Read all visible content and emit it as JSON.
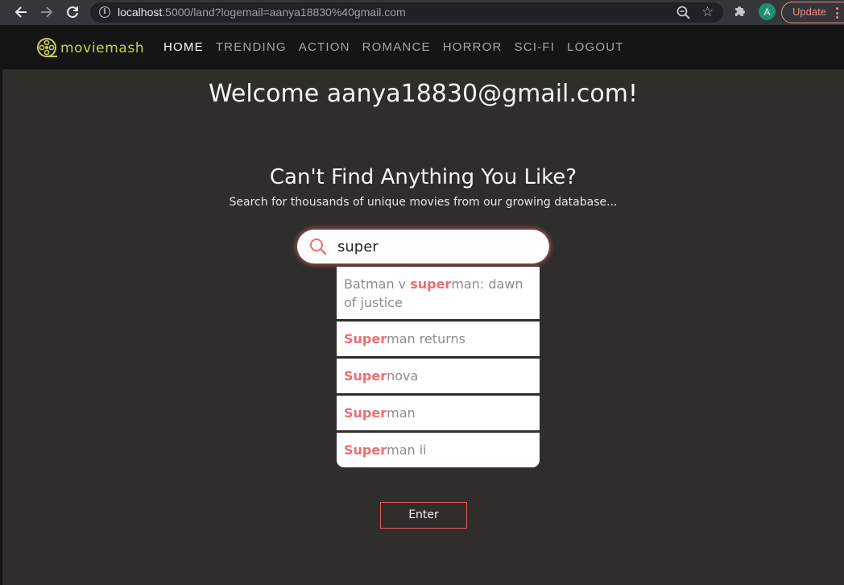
{
  "browser": {
    "url_host": "localhost",
    "url_rest": ":5000/land?logemail=aanya18830%40gmail.com",
    "profile_initial": "A",
    "update_label": "Update",
    "icons": [
      "back-arrow-icon",
      "forward-arrow-icon",
      "reload-icon",
      "site-info-icon",
      "zoom-icon",
      "bookmark-star-icon",
      "extensions-puzzle-icon",
      "kebab-menu-icon"
    ]
  },
  "site": {
    "logo_text": "moviemash",
    "nav": [
      "HOME",
      "TRENDING",
      "ACTION",
      "ROMANCE",
      "HORROR",
      "SCI-FI",
      "LOGOUT"
    ],
    "active_nav": "HOME"
  },
  "main": {
    "welcome": "Welcome aanya18830@gmail.com!",
    "headline": "Can't Find Anything You Like?",
    "subline": "Search for thousands of unique movies from our growing database...",
    "search_value": "super",
    "suggestions": [
      {
        "before": "Batman v ",
        "match": "super",
        "after": "man: dawn of justice"
      },
      {
        "before": "",
        "match": "Super",
        "after": "man returns"
      },
      {
        "before": "",
        "match": "Super",
        "after": "nova"
      },
      {
        "before": "",
        "match": "Super",
        "after": "man"
      },
      {
        "before": "",
        "match": "Super",
        "after": "man ii"
      }
    ],
    "enter_label": "Enter"
  },
  "colors": {
    "accent": "#ee6e73",
    "logo": "#c8d052",
    "background": "#2f2e2b",
    "navbar": "#151515"
  }
}
